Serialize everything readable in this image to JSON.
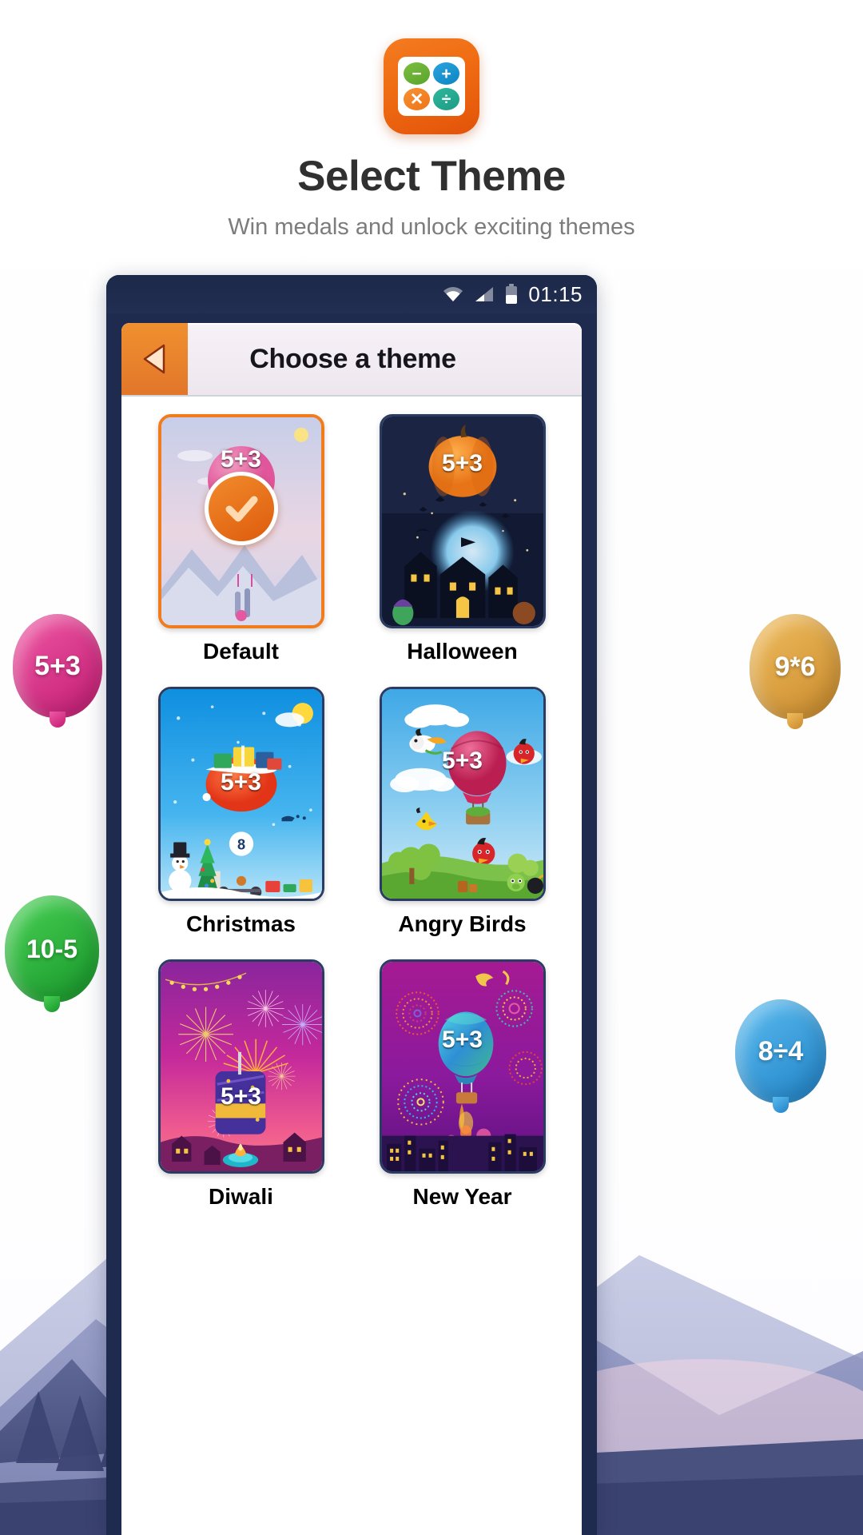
{
  "promo": {
    "app_icon": {
      "name": "calculator-app-icon",
      "background_color": "#ee6a12",
      "operators": [
        {
          "glyph": "−",
          "name": "minus-operator-icon",
          "color": "#6cb234"
        },
        {
          "glyph": "+",
          "name": "plus-operator-icon",
          "color": "#1a92d0"
        },
        {
          "glyph": "✕",
          "name": "multiply-operator-icon",
          "color": "#f28129"
        },
        {
          "glyph": "÷",
          "name": "divide-operator-icon",
          "color": "#26ab92"
        }
      ]
    },
    "title": "Select Theme",
    "subtitle": "Win medals and unlock exciting themes",
    "title_color": "#303030",
    "subtitle_color": "#7c7c7c"
  },
  "phone": {
    "frame_color": "#1e2a4e",
    "status_bar": {
      "clock": "01:15",
      "wifi_icon": "wifi-icon",
      "signal_icon": "cellular-signal-icon",
      "battery_icon": "battery-icon"
    },
    "appbar": {
      "back_icon": "back-triangle-icon",
      "title": "Choose a theme",
      "accent_color": "#e8802b"
    }
  },
  "themes": [
    {
      "label": "Default",
      "badge": "5+3",
      "selected": true,
      "selected_icon": "check-mark-icon",
      "bg_top": "#c9cfea",
      "bg_bottom": "#f3dce4"
    },
    {
      "label": "Halloween",
      "badge": "5+3",
      "selected": false,
      "bg_top": "#1c2340",
      "bg_bottom": "#151b33"
    },
    {
      "label": "Christmas",
      "badge": "5+3",
      "extra_badge": "8",
      "selected": false,
      "bg_top": "#1596e8",
      "bg_bottom": "#8fd4f5"
    },
    {
      "label": "Angry Birds",
      "badge": "5+3",
      "selected": false,
      "bg_top": "#3fa9e8",
      "bg_bottom": "#a9e0f6"
    },
    {
      "label": "Diwali",
      "badge": "5+3",
      "selected": false,
      "bg_top": "#8e2a9c",
      "bg_bottom": "#f0528e"
    },
    {
      "label": "New Year",
      "badge": "5+3",
      "selected": false,
      "bg_top": "#9c1d96",
      "bg_bottom": "#7d199b"
    }
  ],
  "floating_balloons": [
    {
      "text": "5+3",
      "color": "#e0338c",
      "color_dark": "#b81f6e",
      "name": "balloon-addition"
    },
    {
      "text": "9*6",
      "color": "#e3a73e",
      "color_dark": "#c2842a",
      "name": "balloon-multiplication"
    },
    {
      "text": "10-5",
      "color": "#2fbb3c",
      "color_dark": "#1f9a2b",
      "name": "balloon-subtraction"
    },
    {
      "text": "8÷4",
      "color": "#3aa8e8",
      "color_dark": "#2288cc",
      "name": "balloon-division"
    }
  ]
}
